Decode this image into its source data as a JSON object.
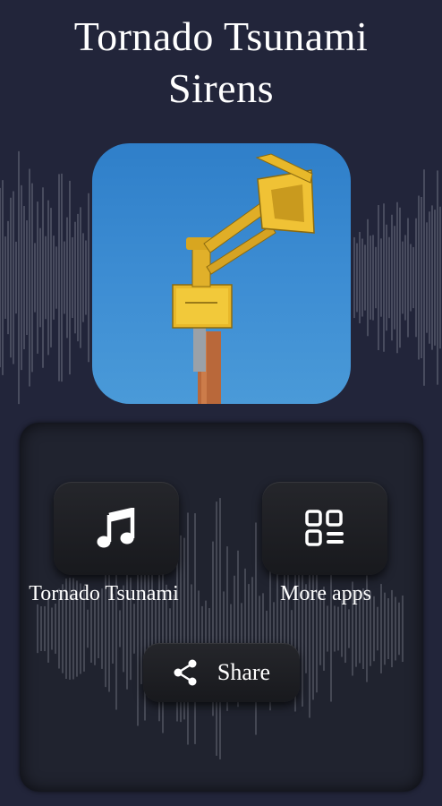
{
  "app": {
    "title_line1": "Tornado Tsunami",
    "title_line2": "Sirens"
  },
  "hero": {
    "image_subject": "tornado siren on a pole",
    "sound_icon": "speaker-volume-icon",
    "sound_button_color": "#d03a3e"
  },
  "menu": {
    "tornado_label": "Tornado Tsunami",
    "tornado_icon": "music-note-icon",
    "more_apps_label": "More apps",
    "more_apps_icon": "apps-grid-icon",
    "share_label": "Share",
    "share_icon": "share-icon"
  },
  "colors": {
    "background": "#22253a",
    "tile": "#1c1d22",
    "text": "#ffffff"
  }
}
